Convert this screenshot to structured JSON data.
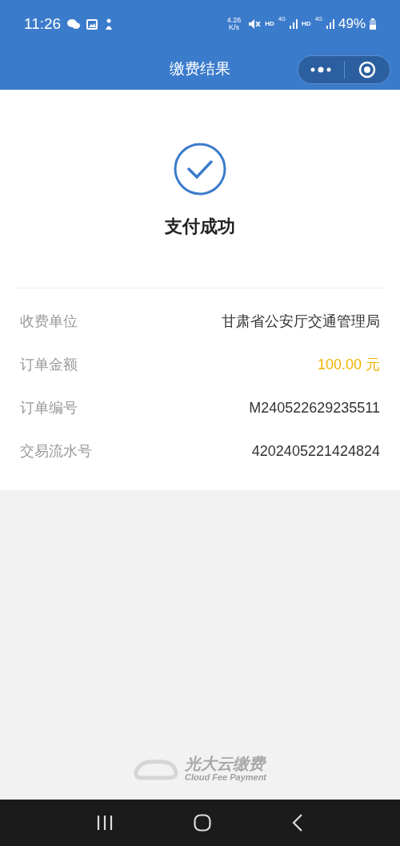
{
  "status_bar": {
    "time": "11:26",
    "speed_value": "4.26",
    "speed_unit": "K/s",
    "hd_1": "HD",
    "network_1": "4G",
    "hd_2": "HD",
    "network_2": "4G",
    "battery": "49%"
  },
  "nav_bar": {
    "title": "缴费结果"
  },
  "result": {
    "message": "支付成功"
  },
  "details": [
    {
      "label": "收费单位",
      "value": "甘肃省公安厅交通管理局",
      "highlight": false
    },
    {
      "label": "订单金额",
      "value": "100.00 元",
      "highlight": true
    },
    {
      "label": "订单编号",
      "value": "M240522629235511",
      "highlight": false
    },
    {
      "label": "交易流水号",
      "value": "4202405221424824",
      "highlight": false
    }
  ],
  "footer": {
    "brand": "光大云缴费",
    "brand_subtitle": "Cloud Fee Payment"
  }
}
